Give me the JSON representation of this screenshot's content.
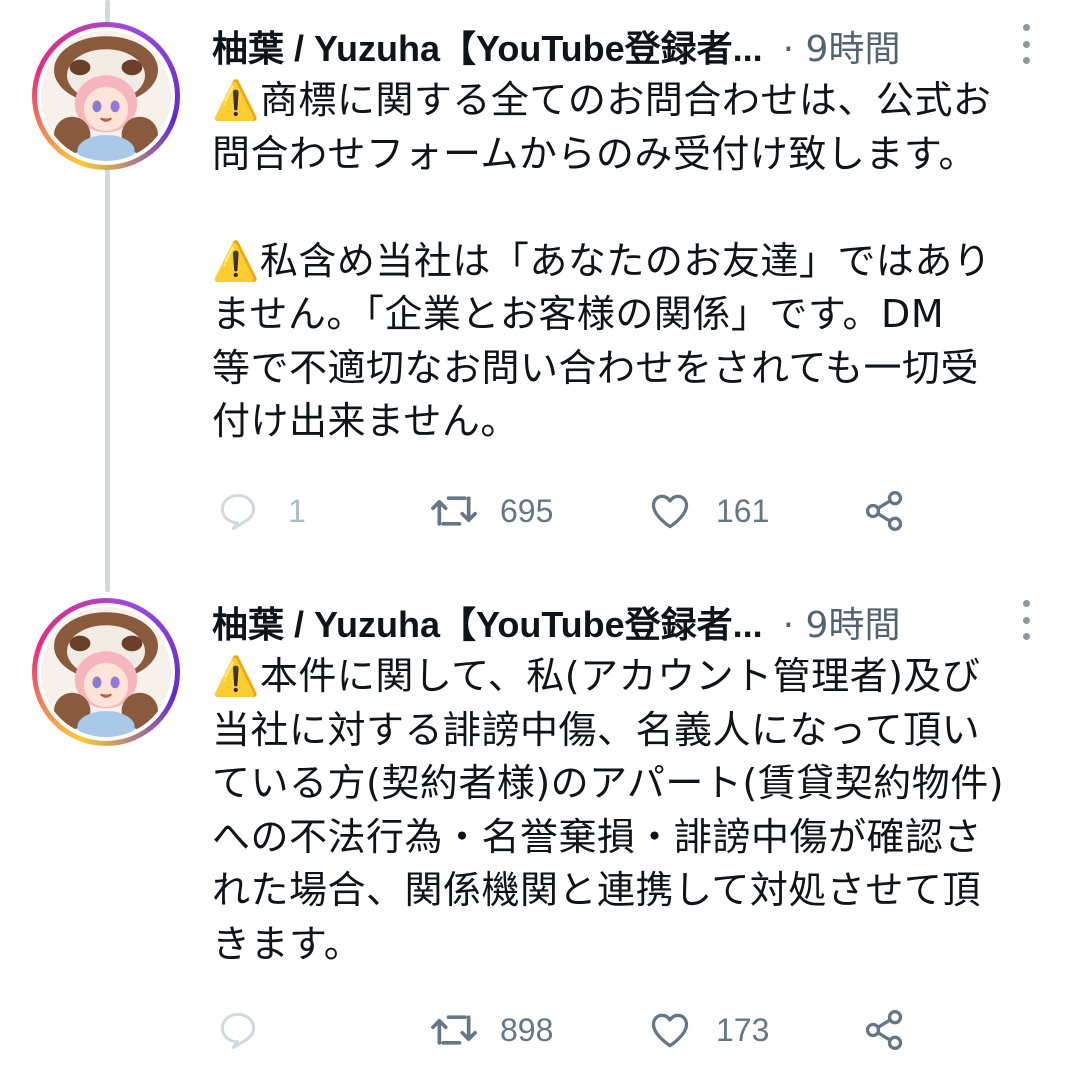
{
  "tweets": [
    {
      "author": "柚葉 / Yuzuha【YouTube登録者...",
      "time": "· 9時間",
      "body": "⚠️商標に関する全てのお問合わせは、公式お\n問合わせフォームからのみ受付け致します。\n\n⚠️私含め当社は「あなたのお友達」ではあり\nません。「企業とお客様の関係」です。DM\n等で不適切なお問い合わせをされても一切受\n付け出来ません。",
      "replies": "1",
      "retweets": "695",
      "likes": "161",
      "icons": [
        "reply-icon",
        "retweet-icon",
        "like-icon",
        "share-icon"
      ]
    },
    {
      "author": "柚葉 / Yuzuha【YouTube登録者...",
      "time": "· 9時間",
      "body": "⚠️本件に関して、私(アカウント管理者)及び\n当社に対する誹謗中傷、名義人になって頂い\nている方(契約者様)のアパート(賃貸契約物件)\nへの不法行為・名誉棄損・誹謗中傷が確認さ\nれた場合、関係機関と連携して対処させて頂\nきます。",
      "replies": "",
      "retweets": "898",
      "likes": "173",
      "icons": [
        "reply-icon",
        "retweet-icon",
        "like-icon",
        "share-icon"
      ]
    }
  ],
  "colors": {
    "text": "#0f1419",
    "muted": "#536471",
    "icon": "#657786",
    "thread_line": "#cfd9de"
  }
}
